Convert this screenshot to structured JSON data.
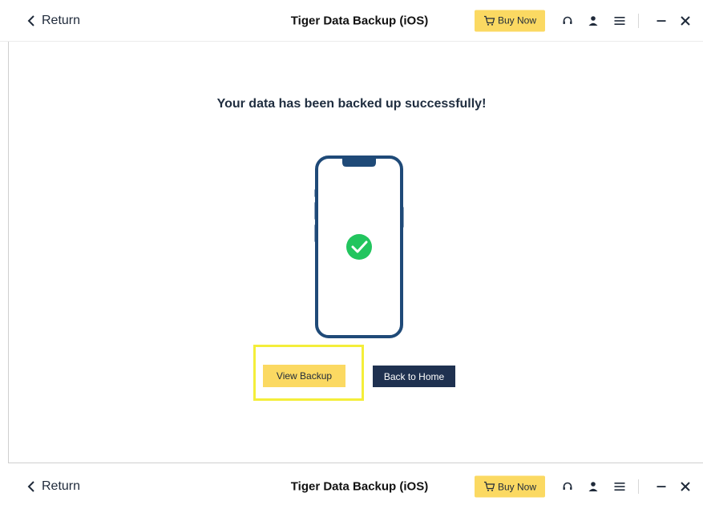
{
  "header": {
    "return_label": "Return",
    "app_title": "Tiger Data Backup (iOS)",
    "buy_label": "Buy Now"
  },
  "main": {
    "headline": "Your data has been backed up successfully!",
    "view_backup_label": "View Backup",
    "back_home_label": "Back to Home"
  },
  "footer_header": {
    "return_label": "Return",
    "app_title": "Tiger Data Backup (iOS)",
    "buy_label": "Buy Now"
  },
  "icons": {
    "return": "chevron-left-icon",
    "cart": "cart-icon",
    "support": "headset-icon",
    "user": "user-icon",
    "menu": "menu-icon",
    "minimize": "minimize-icon",
    "close": "close-icon",
    "phone": "phone-icon",
    "success": "check-circle-icon"
  },
  "colors": {
    "accent_yellow": "#fbd962",
    "navy": "#1f3150",
    "phone_outline": "#1f4a78",
    "success_green": "#22c55e",
    "highlight": "#f4ee3a"
  }
}
